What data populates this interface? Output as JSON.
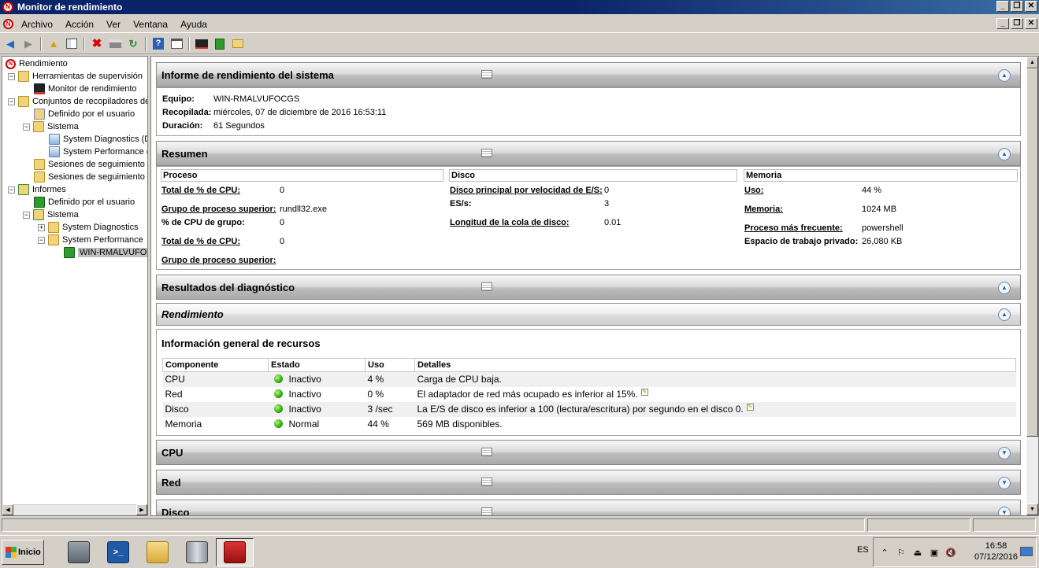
{
  "window": {
    "title": "Monitor de rendimiento"
  },
  "menu": [
    "Archivo",
    "Acción",
    "Ver",
    "Ventana",
    "Ayuda"
  ],
  "tree": {
    "root": "Rendimiento",
    "items": [
      {
        "label": "Herramientas de supervisión"
      },
      {
        "label": "Monitor de rendimiento"
      },
      {
        "label": "Conjuntos de recopiladores de"
      },
      {
        "label": "Definido por el usuario"
      },
      {
        "label": "Sistema"
      },
      {
        "label": "System Diagnostics (D"
      },
      {
        "label": "System Performance ("
      },
      {
        "label": "Sesiones de seguimiento d"
      },
      {
        "label": "Sesiones de seguimiento d"
      },
      {
        "label": "Informes"
      },
      {
        "label": "Definido por el usuario"
      },
      {
        "label": "Sistema"
      },
      {
        "label": "System Diagnostics"
      },
      {
        "label": "System Performance"
      },
      {
        "label": "WIN-RMALVUFOCG"
      }
    ]
  },
  "report": {
    "header": "Informe de rendimiento del sistema",
    "equipo_label": "Equipo:",
    "equipo": "WIN-RMALVUFOCGS",
    "recopilada_label": "Recopilada:",
    "recopilada": "miércoles, 07 de diciembre de 2016 16:53:11",
    "duracion_label": "Duración:",
    "duracion": "61 Segundos"
  },
  "resumen": {
    "header": "Resumen",
    "proceso": {
      "title": "Proceso",
      "rows": [
        {
          "label": "Total de % de CPU:",
          "value": "0"
        },
        {
          "label": "Grupo de proceso superior:",
          "value": "rundll32.exe"
        },
        {
          "label": "% de CPU de grupo:",
          "value": "0"
        },
        {
          "label": "Total de % de CPU:",
          "value": "0"
        },
        {
          "label": "Grupo de proceso superior:",
          "value": ""
        }
      ]
    },
    "disco": {
      "title": "Disco",
      "rows": [
        {
          "label": "Disco principal por velocidad de E/S:",
          "value": "0"
        },
        {
          "label": "ES/s:",
          "value": "3"
        },
        {
          "label": "Longitud de la cola de disco:",
          "value": "0.01"
        }
      ]
    },
    "memoria": {
      "title": "Memoria",
      "rows": [
        {
          "label": "Uso:",
          "value": "44 %"
        },
        {
          "label": "Memoria:",
          "value": "1024 MB"
        },
        {
          "label": "Proceso más frecuente:",
          "value": "powershell"
        },
        {
          "label": "Espacio de trabajo privado:",
          "value": "26,080 KB"
        }
      ]
    }
  },
  "diagnostico": {
    "header": "Resultados del diagnóstico"
  },
  "rendimiento": {
    "header": "Rendimiento",
    "subtitle": "Información general de recursos",
    "columns": [
      "Componente",
      "Estado",
      "Uso",
      "Detalles"
    ],
    "rows": [
      {
        "componente": "CPU",
        "estado": "Inactivo",
        "uso": "4 %",
        "detalles": "Carga de CPU baja."
      },
      {
        "componente": "Red",
        "estado": "Inactivo",
        "uso": "0 %",
        "detalles": "El adaptador de red más ocupado es inferior al 15%."
      },
      {
        "componente": "Disco",
        "estado": "Inactivo",
        "uso": "3 /sec",
        "detalles": "La E/S de disco es inferior a 100 (lectura/escritura) por segundo en el disco 0."
      },
      {
        "componente": "Memoria",
        "estado": "Normal",
        "uso": "44 %",
        "detalles": "569 MB disponibles."
      }
    ]
  },
  "sections": {
    "cpu": "CPU",
    "red": "Red",
    "disco": "Disco"
  },
  "taskbar": {
    "start": "Inicio",
    "lang": "ES",
    "time": "16:58",
    "date": "07/12/2016"
  },
  "colors": {
    "titlebar": "#0a246a",
    "status_green": "#1f9a00",
    "window_bg": "#d4d0c8"
  }
}
